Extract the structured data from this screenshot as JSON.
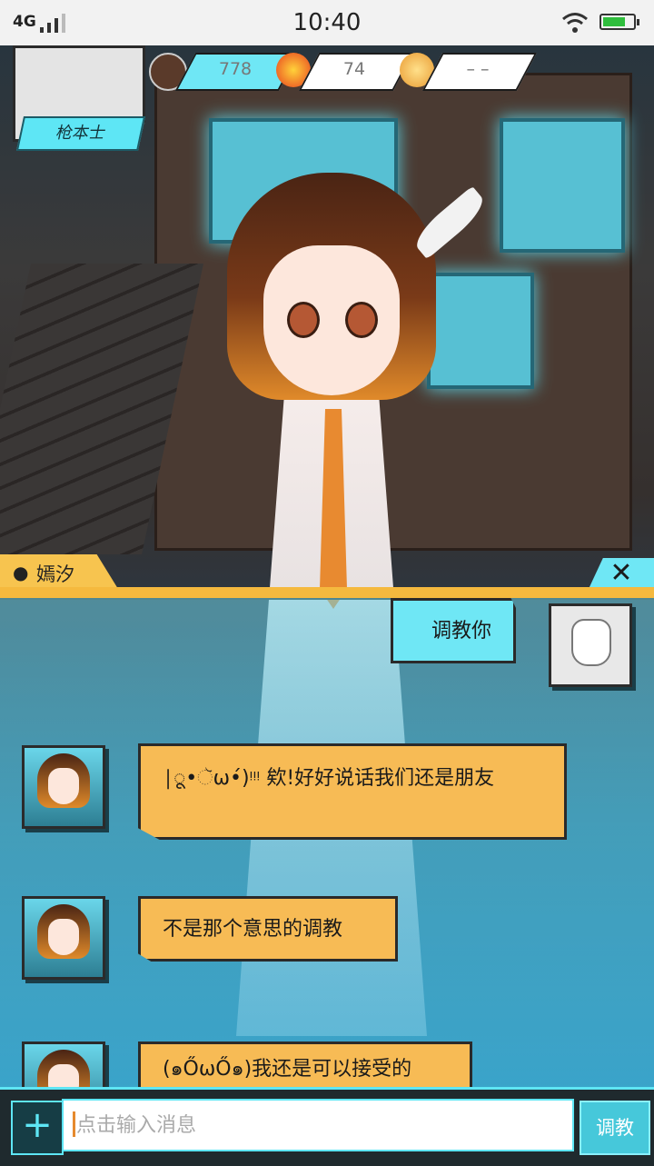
{
  "status_bar": {
    "network": "4G",
    "time": "10:40"
  },
  "hud": {
    "player_name": "枪本士",
    "stats": [
      {
        "icon": "avatar-icon",
        "value": "778"
      },
      {
        "icon": "flame-icon",
        "value": "74"
      },
      {
        "icon": "wing-icon",
        "value": "– –"
      }
    ]
  },
  "chat": {
    "character_name": "嫣汐",
    "close_label": "✕",
    "messages": [
      {
        "sender": "user",
        "text": "调教你"
      },
      {
        "sender": "character",
        "text": "|ू•ૅω•́)ᵎᵎᵎ 欸!好好说话我们还是朋友"
      },
      {
        "sender": "character",
        "text": "不是那个意思的调教"
      },
      {
        "sender": "character",
        "text": "(๑ŐωŐ๑)我还是可以接受的"
      }
    ]
  },
  "input": {
    "plus_label": "+",
    "placeholder": "点击输入消息",
    "send_label": "调教"
  },
  "colors": {
    "accent_cyan": "#6fe7f5",
    "accent_orange": "#f7bb55"
  }
}
